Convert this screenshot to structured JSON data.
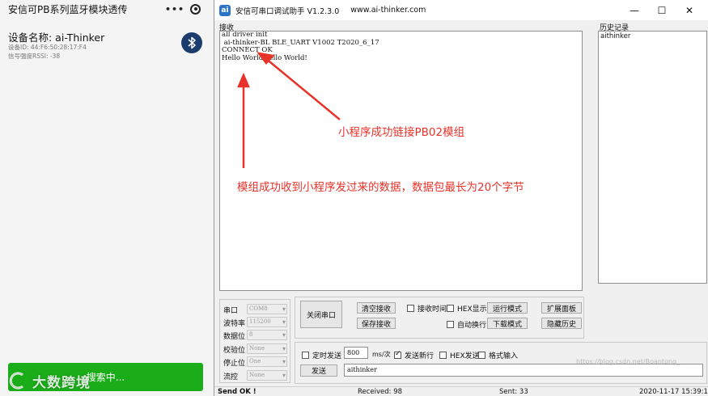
{
  "mini_program": {
    "title": "安信可PB系列蓝牙模块透传",
    "device_name": "设备名称: ai-Thinker",
    "device_id": "设备ID: 44:F6:50:28:17:F4",
    "rssi": "信号强度RSSI: -38",
    "search_button": "搜索中...",
    "watermark": "大数跨境",
    "bluetooth_color": "#1b3d6e",
    "button_color": "#1aad19"
  },
  "serial_tool": {
    "title": "安信可串口调试助手 V1.2.3.0",
    "url": "www.ai-thinker.com",
    "icon_label": "ai",
    "receive_label": "接收",
    "history_label": "历史记录",
    "receive_lines": [
      "all driver init",
      " ai-thinker-BL BLE_UART V1002 T2020_6_17",
      "",
      "CONNECT OK",
      "Hello WorldHello World!"
    ],
    "history_items": [
      "aithinker"
    ],
    "settings": [
      {
        "label": "串口",
        "value": "COM8"
      },
      {
        "label": "波特率",
        "value": "115200"
      },
      {
        "label": "数据位",
        "value": "8"
      },
      {
        "label": "校验位",
        "value": "None"
      },
      {
        "label": "停止位",
        "value": "One"
      },
      {
        "label": "流控",
        "value": "None"
      }
    ],
    "buttons": {
      "close_port": "关闭串口",
      "clear_receive": "清空接收",
      "save_receive": "保存接收",
      "run_mode": "运行模式",
      "download_mode": "下载模式",
      "expand_panel": "扩展面板",
      "hide_history": "隐藏历史",
      "send": "发送"
    },
    "checks": {
      "recv_time": "接收时间",
      "hex_display": "HEX显示",
      "auto_wrap": "自动换行",
      "timed_send": "定时发送",
      "send_newline": "发送新行",
      "hex_send": "HEX发送",
      "format_input": "格式输入"
    },
    "interval_value": "800",
    "interval_unit": "ms/次",
    "send_text": "aithinker",
    "status": {
      "send_ok": "Send OK !",
      "received": "Received: 98",
      "sent": "Sent: 33",
      "datetime": "2020-11-17 15:39:17"
    },
    "blog_watermark": "https://blog.csdn.net/Boantong_"
  },
  "annotations": {
    "connect": "小程序成功链接PB02模组",
    "receive": "模组成功收到小程序发过来的数据，数据包最长为20个字节",
    "color": "#e8332a"
  }
}
